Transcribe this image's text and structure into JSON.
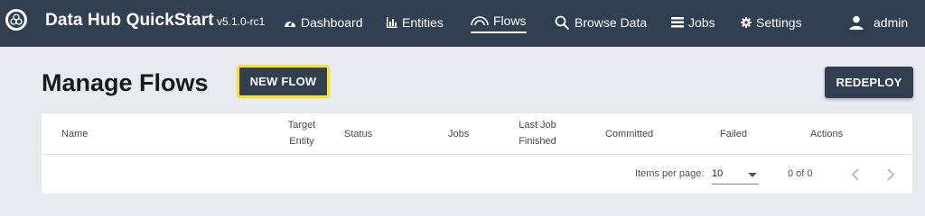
{
  "app": {
    "title": "Data Hub QuickStart",
    "version": "v5.1.0-rc1"
  },
  "nav": {
    "dashboard": "Dashboard",
    "entities": "Entities",
    "flows": "Flows",
    "browse": "Browse Data",
    "jobs": "Jobs",
    "settings": "Settings",
    "user": "admin"
  },
  "page": {
    "title": "Manage Flows",
    "new_flow_label": "NEW FLOW",
    "redeploy_label": "REDEPLOY"
  },
  "table": {
    "columns": {
      "name": "Name",
      "target_entity_1": "Target",
      "target_entity_2": "Entity",
      "status": "Status",
      "jobs": "Jobs",
      "last_job_1": "Last Job",
      "last_job_2": "Finished",
      "committed": "Committed",
      "failed": "Failed",
      "actions": "Actions"
    },
    "paginator": {
      "items_per_page_label": "Items per page:",
      "items_per_page": "10",
      "range": "0 of 0"
    }
  },
  "colors": {
    "navbar": "#323f50",
    "highlight": "#f1e54a"
  }
}
